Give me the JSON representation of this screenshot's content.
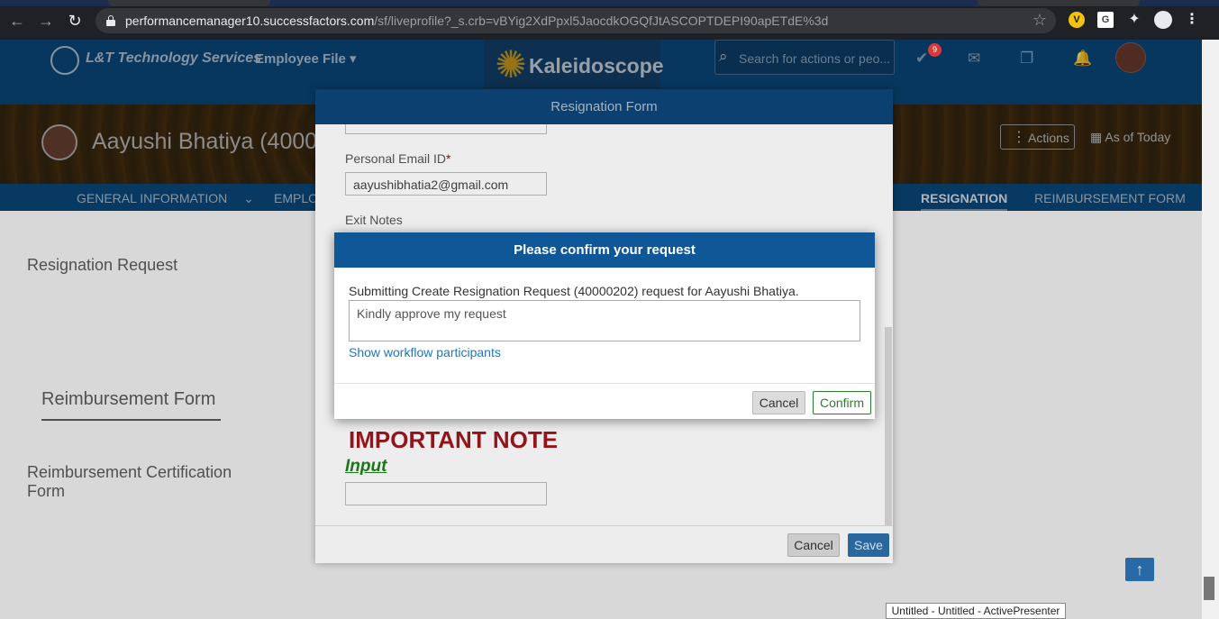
{
  "browser": {
    "url_host": "performancemanager10.successfactors.com",
    "url_path": "/sf/liveprofile?_s.crb=vBYig2XdPpxl5JaocdkOGQfJtASCOPTDEPI90apETdE%3d",
    "ext_v": "V",
    "ext_g": "G"
  },
  "header": {
    "company": "L&T Technology Services",
    "module": "Employee File",
    "brand": "Kaleidoscope",
    "search_placeholder": "Search for actions or peo...",
    "todo_count": "9"
  },
  "profile": {
    "name": "Aayushi Bhatiya (40000",
    "actions_label": "Actions",
    "as_of_label": "As of Today"
  },
  "tabs": [
    "GENERAL INFORMATION",
    "EMPLO",
    "RESIGNATION",
    "REIMBURSEMENT FORM"
  ],
  "main": {
    "resignation_request": "Resignation Request",
    "reimbursement_form": "Reimbursement Form",
    "reimbursement_cert": "Reimbursement Certification Form"
  },
  "resignation_form": {
    "title": "Resignation Form",
    "personal_email_label": "Personal Email ID",
    "required_mark": "*",
    "personal_email_value": "aayushibhatia2@gmail.com",
    "exit_notes_label": "Exit Notes",
    "important_note": "IMPORTANT NOTE",
    "input_label": "Input",
    "cancel_label": "Cancel",
    "save_label": "Save"
  },
  "confirm_dialog": {
    "title": "Please confirm your request",
    "message": "Submitting Create Resignation Request (40000202) request for Aayushi Bhatiya.",
    "comment": "Kindly approve my request",
    "workflow_link": "Show workflow participants",
    "cancel_label": "Cancel",
    "confirm_label": "Confirm"
  },
  "tooltip": "Untitled - Untitled - ActivePresenter",
  "colors": {
    "header_blue": "#0a4a7f",
    "dialog_header": "#0f5796",
    "important_red": "#a0161f",
    "input_green": "#1c7f1c",
    "link_blue": "#1b78c2"
  }
}
